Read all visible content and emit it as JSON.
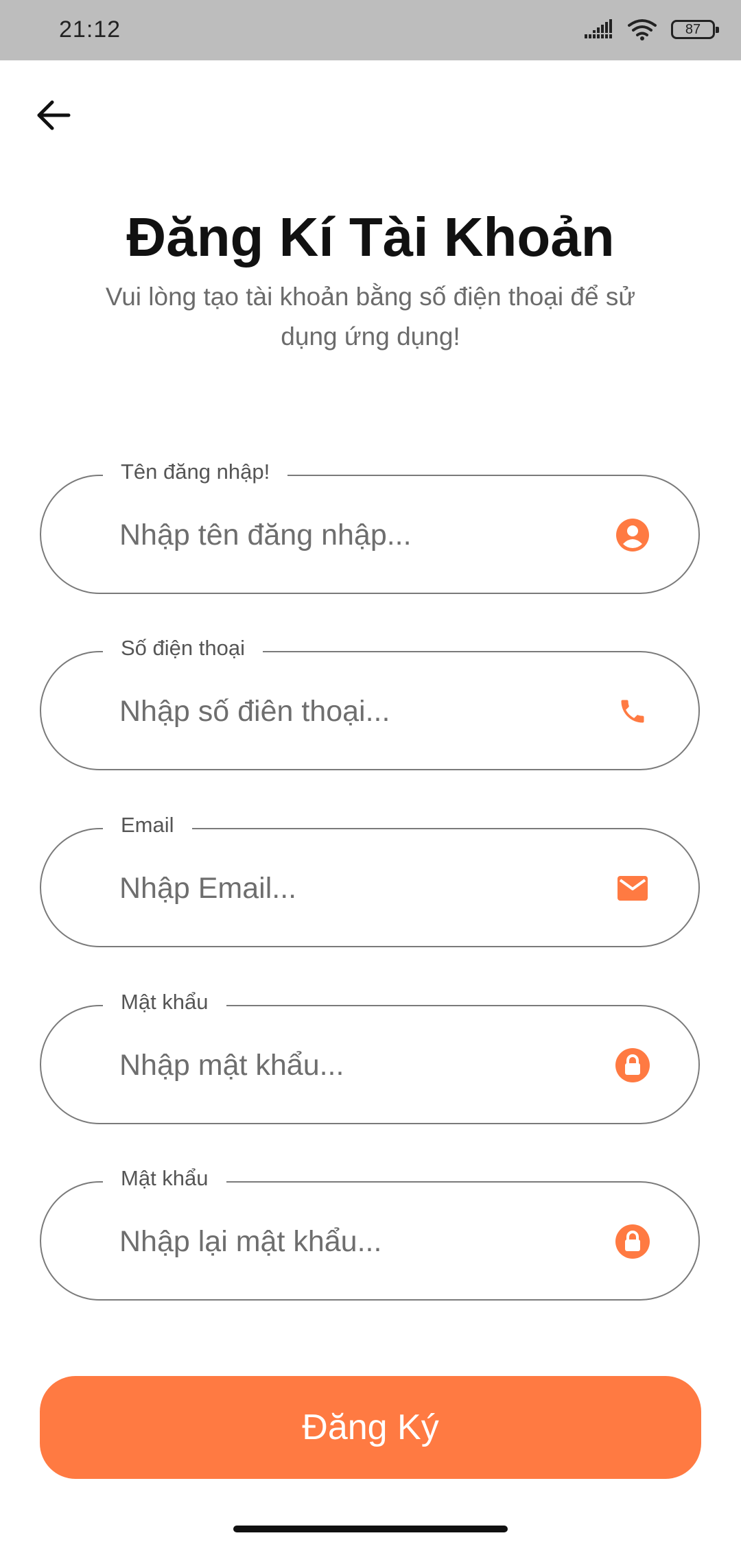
{
  "status_bar": {
    "time": "21:12",
    "battery": "87"
  },
  "header": {
    "back_icon": "arrow-left-icon",
    "title": "Đăng Kí Tài Khoản",
    "subtitle": "Vui lòng tạo tài khoản bằng số điện thoại để sử dụng ứng dụng!"
  },
  "form": {
    "fields": [
      {
        "label": "Tên đăng nhập!",
        "placeholder": "Nhập tên đăng nhập...",
        "value": "",
        "icon": "account-circle-icon"
      },
      {
        "label": "Số điện thoại",
        "placeholder": "Nhập số điên thoại...",
        "value": "",
        "icon": "phone-icon"
      },
      {
        "label": "Email",
        "placeholder": "Nhập Email...",
        "value": "",
        "icon": "email-icon"
      },
      {
        "label": "Mật khẩu",
        "placeholder": "Nhập mật khẩu...",
        "value": "",
        "icon": "lock-icon"
      },
      {
        "label": "Mật khẩu",
        "placeholder": "Nhập lại mật khẩu...",
        "value": "",
        "icon": "lock-icon"
      }
    ],
    "submit_label": "Đăng Ký"
  },
  "colors": {
    "accent": "#ff7a42",
    "status_bar_bg": "#bdbdbd",
    "border": "#7a7a7a"
  }
}
